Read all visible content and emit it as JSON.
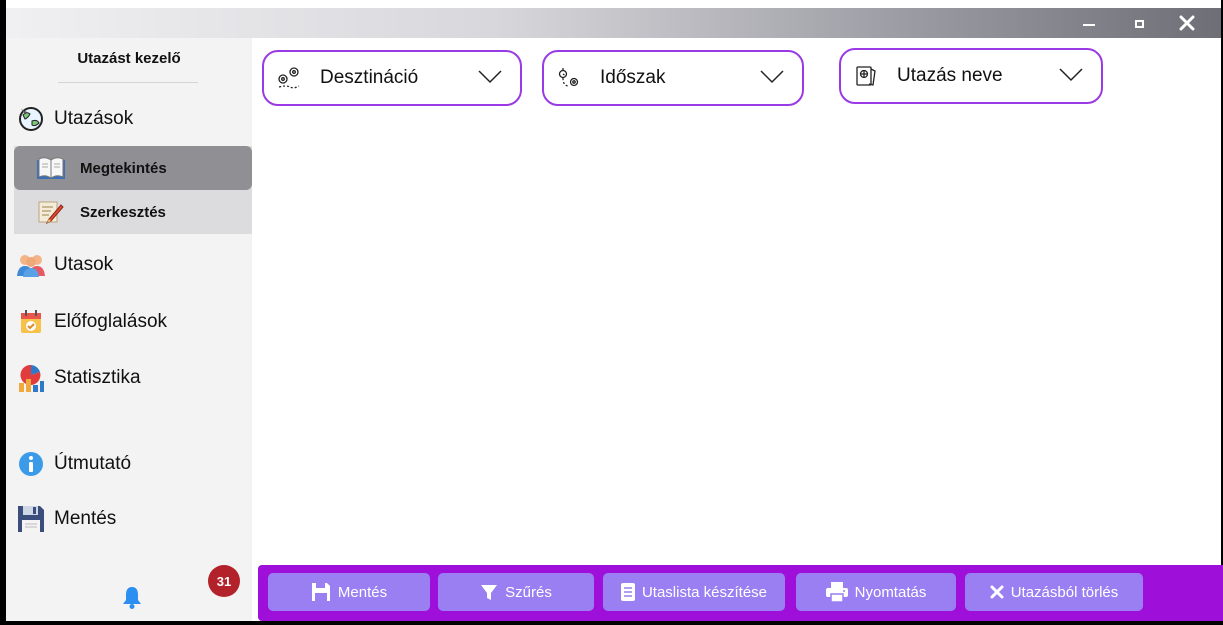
{
  "window": {
    "controls": {
      "minimize": "minimize-icon",
      "maximize": "maximize-icon",
      "close": "close-icon"
    }
  },
  "sidebar": {
    "title": "Utazást kezelő",
    "items": [
      {
        "label": "Utazások",
        "icon": "globe-travel-icon"
      },
      {
        "label": "Utasok",
        "icon": "people-icon"
      },
      {
        "label": "Előfoglalások",
        "icon": "calendar-icon"
      },
      {
        "label": "Statisztika",
        "icon": "statistics-icon"
      },
      {
        "label": "Útmutató",
        "icon": "info-icon"
      },
      {
        "label": "Mentés",
        "icon": "floppy-disk-icon"
      }
    ],
    "subitems": [
      {
        "label": "Megtekintés",
        "icon": "open-book-icon",
        "active": true
      },
      {
        "label": "Szerkesztés",
        "icon": "edit-pencil-icon",
        "active": false
      }
    ],
    "notifications": {
      "icon": "bell-icon",
      "count": "31"
    }
  },
  "filters": [
    {
      "label": "Desztináció",
      "icon": "destination-pins-icon"
    },
    {
      "label": "Időszak",
      "icon": "period-route-icon"
    },
    {
      "label": "Utazás neve",
      "icon": "ticket-icon"
    }
  ],
  "toolbar": {
    "buttons": [
      {
        "label": "Mentés",
        "icon": "floppy-disk-icon"
      },
      {
        "label": "Szűrés",
        "icon": "filter-funnel-icon"
      },
      {
        "label": "Utaslista készítése",
        "icon": "document-list-icon"
      },
      {
        "label": "Nyomtatás",
        "icon": "printer-icon"
      },
      {
        "label": "Utazásból törlés",
        "icon": "x-delete-icon"
      }
    ]
  },
  "colors": {
    "accent": "#9a39e6",
    "toolbar_bg": "#9e0fd9",
    "button_bg": "#9a7ff2",
    "badge": "#b3222a",
    "bell": "#2a8ff0"
  }
}
